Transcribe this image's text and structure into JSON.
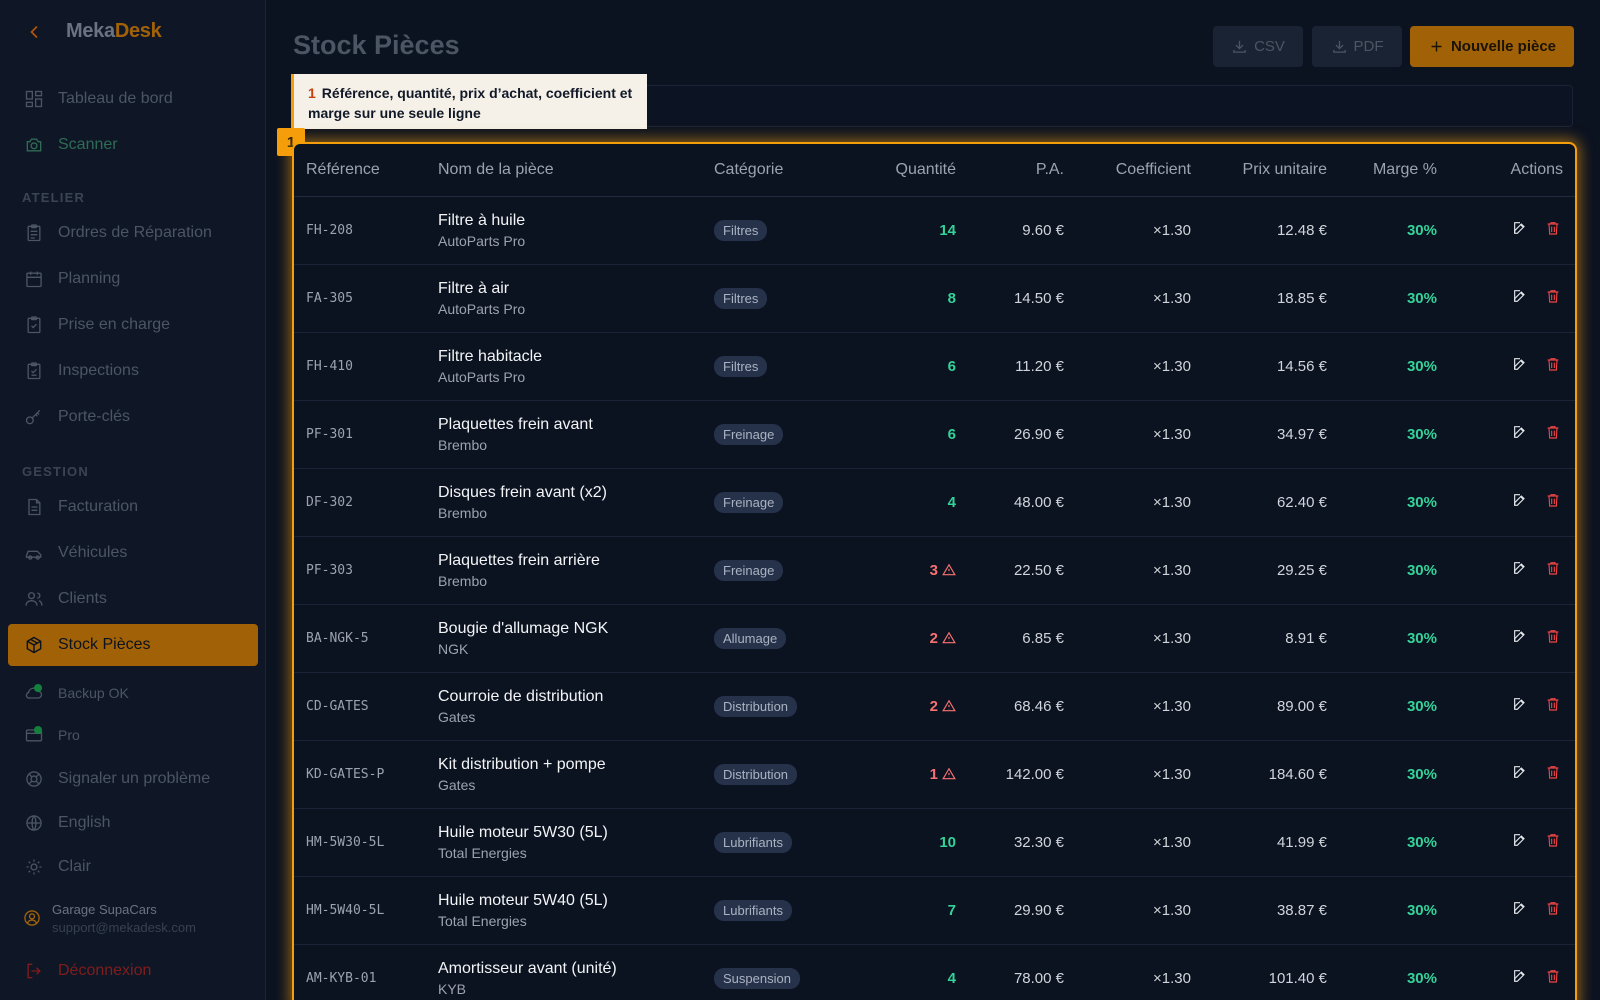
{
  "app": {
    "logo_part1": "Meka",
    "logo_part2": "Desk"
  },
  "sidebar": {
    "items": [
      {
        "label": "Tableau de bord",
        "icon": "dashboard-icon"
      },
      {
        "label": "Scanner",
        "icon": "camera-icon"
      },
      {
        "label": "Ordres de Réparation",
        "icon": "clipboard-icon"
      },
      {
        "label": "Planning",
        "icon": "calendar-icon"
      },
      {
        "label": "Prise en charge",
        "icon": "clipboard-check-icon"
      },
      {
        "label": "Inspections",
        "icon": "clipboard-list-icon"
      },
      {
        "label": "Porte-clés",
        "icon": "key-icon"
      },
      {
        "label": "Facturation",
        "icon": "document-icon"
      },
      {
        "label": "Véhicules",
        "icon": "car-icon"
      },
      {
        "label": "Clients",
        "icon": "users-icon"
      },
      {
        "label": "Stock Pièces",
        "icon": "package-icon"
      }
    ],
    "sections": {
      "atelier": "ATELIER",
      "gestion": "GESTION"
    },
    "backup": "Backup OK",
    "plan": "Pro",
    "report": "Signaler un problème",
    "language": "English",
    "theme": "Clair",
    "user_name": "Garage SupaCars",
    "user_email": "support@mekadesk.com",
    "logout": "Déconnexion"
  },
  "header": {
    "title": "Stock Pièces",
    "csv": "CSV",
    "pdf": "PDF",
    "new_part": "Nouvelle pièce"
  },
  "callout": {
    "number": "1",
    "text": "Référence, quantité, prix d’achat, coefficient et marge sur une seule ligne",
    "badge": "1"
  },
  "table": {
    "columns": [
      "Référence",
      "Nom de la pièce",
      "Catégorie",
      "Quantité",
      "P.A.",
      "Coefficient",
      "Prix unitaire",
      "Marge %",
      "Actions"
    ],
    "rows": [
      {
        "ref": "FH-208",
        "name": "Filtre à huile",
        "supplier": "AutoParts Pro",
        "category": "Filtres",
        "qty": "14",
        "low": false,
        "pa": "9.60 €",
        "coef": "×1.30",
        "price": "12.48 €",
        "margin": "30%"
      },
      {
        "ref": "FA-305",
        "name": "Filtre à air",
        "supplier": "AutoParts Pro",
        "category": "Filtres",
        "qty": "8",
        "low": false,
        "pa": "14.50 €",
        "coef": "×1.30",
        "price": "18.85 €",
        "margin": "30%"
      },
      {
        "ref": "FH-410",
        "name": "Filtre habitacle",
        "supplier": "AutoParts Pro",
        "category": "Filtres",
        "qty": "6",
        "low": false,
        "pa": "11.20 €",
        "coef": "×1.30",
        "price": "14.56 €",
        "margin": "30%"
      },
      {
        "ref": "PF-301",
        "name": "Plaquettes frein avant",
        "supplier": "Brembo",
        "category": "Freinage",
        "qty": "6",
        "low": false,
        "pa": "26.90 €",
        "coef": "×1.30",
        "price": "34.97 €",
        "margin": "30%"
      },
      {
        "ref": "DF-302",
        "name": "Disques frein avant (x2)",
        "supplier": "Brembo",
        "category": "Freinage",
        "qty": "4",
        "low": false,
        "pa": "48.00 €",
        "coef": "×1.30",
        "price": "62.40 €",
        "margin": "30%"
      },
      {
        "ref": "PF-303",
        "name": "Plaquettes frein arrière",
        "supplier": "Brembo",
        "category": "Freinage",
        "qty": "3",
        "low": true,
        "pa": "22.50 €",
        "coef": "×1.30",
        "price": "29.25 €",
        "margin": "30%"
      },
      {
        "ref": "BA-NGK-5",
        "name": "Bougie d'allumage NGK",
        "supplier": "NGK",
        "category": "Allumage",
        "qty": "2",
        "low": true,
        "pa": "6.85 €",
        "coef": "×1.30",
        "price": "8.91 €",
        "margin": "30%"
      },
      {
        "ref": "CD-GATES",
        "name": "Courroie de distribution",
        "supplier": "Gates",
        "category": "Distribution",
        "qty": "2",
        "low": true,
        "pa": "68.46 €",
        "coef": "×1.30",
        "price": "89.00 €",
        "margin": "30%"
      },
      {
        "ref": "KD-GATES-P",
        "name": "Kit distribution + pompe",
        "supplier": "Gates",
        "category": "Distribution",
        "qty": "1",
        "low": true,
        "pa": "142.00 €",
        "coef": "×1.30",
        "price": "184.60 €",
        "margin": "30%"
      },
      {
        "ref": "HM-5W30-5L",
        "name": "Huile moteur 5W30 (5L)",
        "supplier": "Total Energies",
        "category": "Lubrifiants",
        "qty": "10",
        "low": false,
        "pa": "32.30 €",
        "coef": "×1.30",
        "price": "41.99 €",
        "margin": "30%"
      },
      {
        "ref": "HM-5W40-5L",
        "name": "Huile moteur 5W40 (5L)",
        "supplier": "Total Energies",
        "category": "Lubrifiants",
        "qty": "7",
        "low": false,
        "pa": "29.90 €",
        "coef": "×1.30",
        "price": "38.87 €",
        "margin": "30%"
      },
      {
        "ref": "AM-KYB-01",
        "name": "Amortisseur avant (unité)",
        "supplier": "KYB",
        "category": "Suspension",
        "qty": "4",
        "low": false,
        "pa": "78.00 €",
        "coef": "×1.30",
        "price": "101.40 €",
        "margin": "30%"
      }
    ]
  },
  "colors": {
    "accent": "#f59e0b",
    "ok": "#34d399",
    "low": "#f87171",
    "background": "#0b1220"
  }
}
